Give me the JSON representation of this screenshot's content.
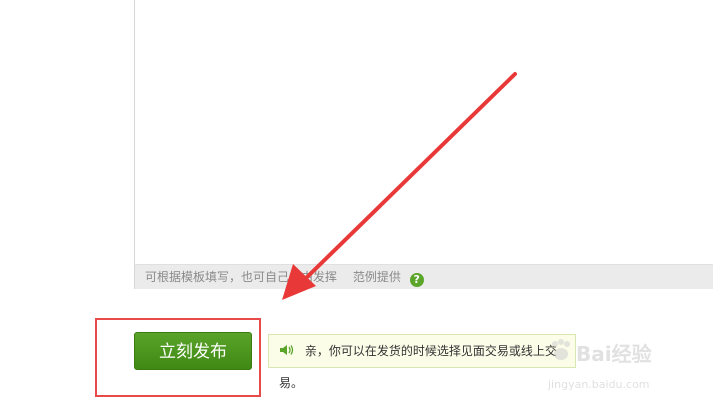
{
  "editor": {
    "footer_hint": "可根据模板填写，也可自己自由发挥",
    "footer_example": "范例提供",
    "help_icon": "?"
  },
  "publish": {
    "label": "立刻发布"
  },
  "tip": {
    "text": "亲，你可以在发货的时候选择见面交易或线上交易。"
  },
  "watermark": {
    "logo_text": "Bai经验",
    "url": "jingyan.baidu.com"
  },
  "colors": {
    "accent_green": "#4a9a1f",
    "highlight_red": "#e84a4a",
    "tip_bg": "#fbfde8"
  }
}
